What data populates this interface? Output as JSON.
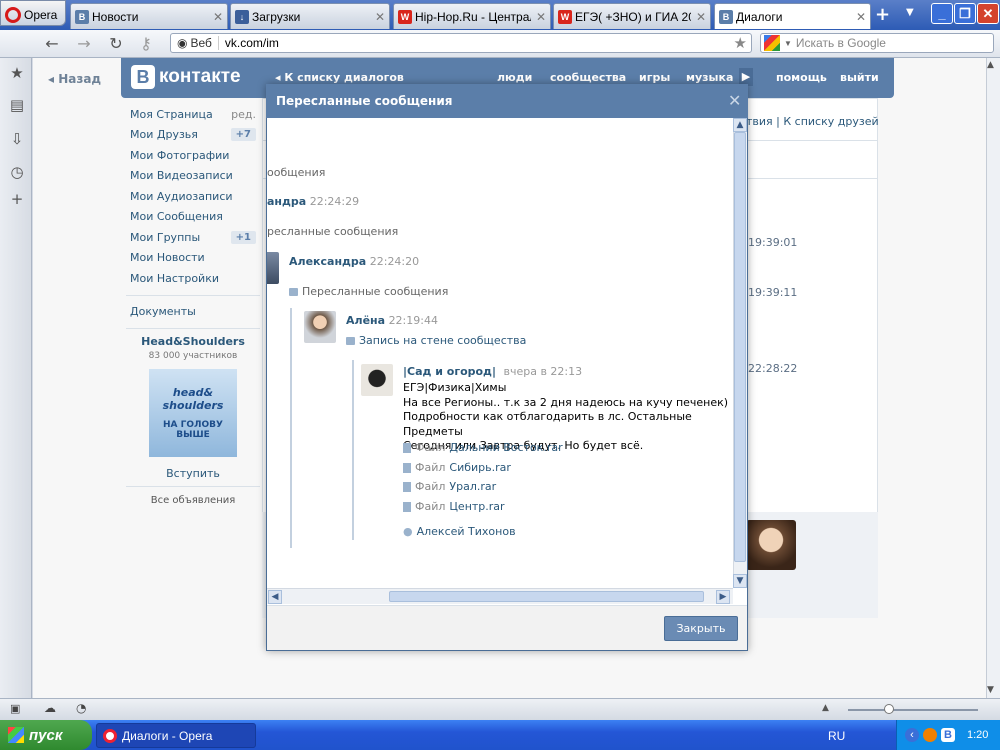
{
  "browser": {
    "menu_label": "Opera",
    "tabs": [
      {
        "title": "Новости",
        "icon": "vk-icon",
        "icon_text": "B"
      },
      {
        "title": "Загрузки",
        "icon": "downloads-icon",
        "icon_text": "↓"
      },
      {
        "title": "Hip-Hop.Ru - Централ...",
        "icon": "hiphop-icon",
        "icon_text": "W"
      },
      {
        "title": "ЕГЭ( +ЗНО) и ГИА 20...",
        "icon": "ege-icon",
        "icon_text": "W"
      },
      {
        "title": "Диалоги",
        "icon": "vk-icon",
        "icon_text": "B",
        "active": true
      }
    ],
    "address": {
      "web_label": "Веб",
      "url": "vk.com/im"
    },
    "search_placeholder": "Искать в Google"
  },
  "vk": {
    "back_label": "Назад",
    "logo_text": "контакте",
    "logo_letter": "B",
    "back_to_dialogs": "К списку диалогов",
    "top_links": [
      "люди",
      "сообщества",
      "игры",
      "музыка",
      "помощь",
      "выйти"
    ],
    "menu": [
      {
        "label": "Моя Страница",
        "extra": "ред."
      },
      {
        "label": "Мои Друзья",
        "badge": "+7"
      },
      {
        "label": "Мои Фотографии"
      },
      {
        "label": "Мои Видеозаписи"
      },
      {
        "label": "Мои Аудиозаписи"
      },
      {
        "label": "Мои Сообщения"
      },
      {
        "label": "Мои Группы",
        "badge": "+1"
      },
      {
        "label": "Мои Новости"
      },
      {
        "label": "Мои Настройки"
      }
    ],
    "documents": "Документы",
    "ad": {
      "title": "Head&Shoulders",
      "members": "83 000 участников",
      "brand1": "head&",
      "brand2": "shoulders",
      "slogan1": "НА ГОЛОВУ",
      "slogan2": "ВЫШЕ",
      "join": "Вступить",
      "all_ads": "Все объявления"
    },
    "right": {
      "header_links": "твия | К списку друзей",
      "times": [
        "19:39:01",
        "19:39:11",
        "22:28:22"
      ]
    }
  },
  "modal": {
    "title": "Пересланные сообщения",
    "close_label": "Закрыть",
    "lines": {
      "fwd_partial": "ообщения",
      "name_partial": "андра",
      "time_partial": "22:24:29",
      "fwd_partial2": "ресланные сообщения"
    },
    "msg1": {
      "name": "Александра",
      "time": "22:24:20",
      "fwd": "Пересланные сообщения"
    },
    "msg2": {
      "name": "Алёна",
      "time": "22:19:44",
      "wall": "Запись на стене сообщества"
    },
    "post": {
      "name": "|Сад и огород|",
      "time": "вчера в 22:13",
      "text": [
        "ЕГЭ|Физика|Химы",
        "На все Регионы.. т.к за 2 дня надеюсь на кучу печенек)",
        "Подробности как отблагодарить в лс. Остальные Предметы",
        "Сегодня или Завтра будут. Но будет всё."
      ],
      "file_label": "Файл",
      "files": [
        "Дальний Восток.rar",
        "Сибирь.rar",
        "Урал.rar",
        "Центр.rar"
      ],
      "author": "Алексей Тихонов"
    }
  },
  "taskbar": {
    "start": "пуск",
    "item": "Диалоги - Opera",
    "lang": "RU",
    "clock": "1:20"
  }
}
